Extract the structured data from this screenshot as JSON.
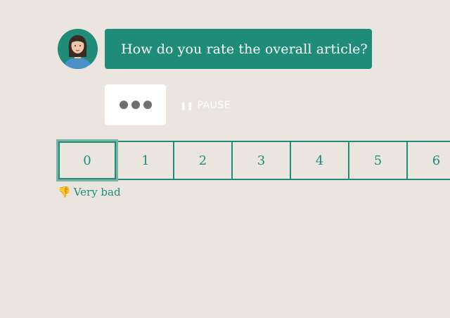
{
  "question": {
    "text": "How do you rate the overall article?"
  },
  "avatar": {
    "icon": "person-avatar-icon"
  },
  "typing": {
    "icon": "typing-dots-icon"
  },
  "pause": {
    "icon": "pause-icon",
    "label": "PAUSE"
  },
  "scale": {
    "options": [
      "0",
      "1",
      "2",
      "3",
      "4",
      "5",
      "6"
    ],
    "selected": "0"
  },
  "hint": {
    "icon": "thumbs-down-icon",
    "label": "Very bad"
  },
  "colors": {
    "accent": "#1f8c79",
    "background": "#ebe5df",
    "typing_bg": "#ffffff"
  }
}
